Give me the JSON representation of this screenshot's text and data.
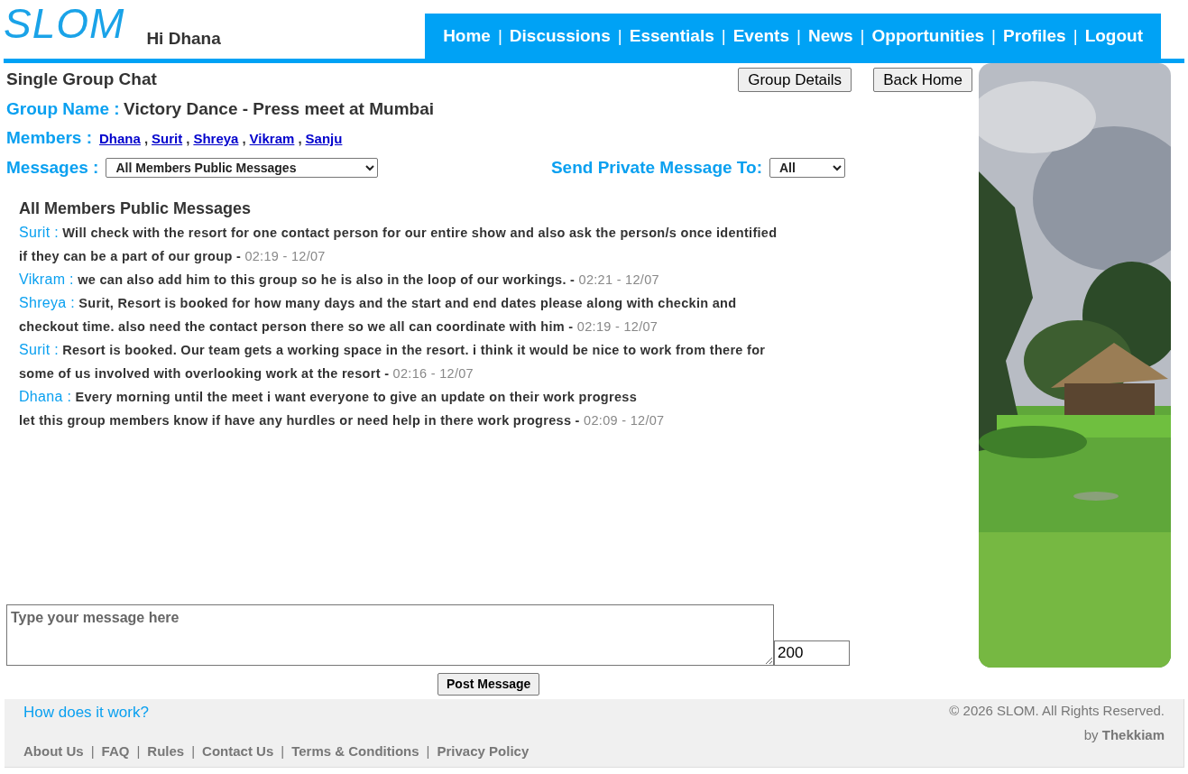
{
  "header": {
    "logo": "SLOM",
    "greeting": "Hi Dhana",
    "nav": [
      {
        "kind": "link",
        "label": "Home"
      },
      {
        "kind": "separator",
        "label": "|"
      },
      {
        "kind": "link",
        "label": "Discussions"
      },
      {
        "kind": "separator",
        "label": "|"
      },
      {
        "kind": "link",
        "label": "Essentials"
      },
      {
        "kind": "separator",
        "label": "|"
      },
      {
        "kind": "link",
        "label": "Events"
      },
      {
        "kind": "separator",
        "label": "|"
      },
      {
        "kind": "link",
        "label": "News"
      },
      {
        "kind": "separator",
        "label": "|"
      },
      {
        "kind": "link",
        "label": "Opportunities"
      },
      {
        "kind": "separator",
        "label": "|"
      },
      {
        "kind": "link",
        "label": "Profiles"
      },
      {
        "kind": "separator",
        "label": "|"
      },
      {
        "kind": "link",
        "label": "Logout"
      }
    ]
  },
  "page_title": "Single Group Chat",
  "buttons": [
    "Group Details",
    "Back Home"
  ],
  "group_name": {
    "label": "Group Name :",
    "value": "Victory Dance - Press meet at Mumbai"
  },
  "members": {
    "label": "Members :",
    "items": [
      {
        "kind": "link",
        "label": "Dhana"
      },
      {
        "kind": "separator",
        "label": ","
      },
      {
        "kind": "link",
        "label": "Surit"
      },
      {
        "kind": "separator",
        "label": ","
      },
      {
        "kind": "link",
        "label": "Shreya"
      },
      {
        "kind": "separator",
        "label": ","
      },
      {
        "kind": "link",
        "label": "Vikram"
      },
      {
        "kind": "separator",
        "label": ","
      },
      {
        "kind": "link",
        "label": "Sanju"
      }
    ]
  },
  "messages_filter": {
    "label": "Messages :",
    "value": "All Members Public Messages"
  },
  "private_to": {
    "label": "Send Private Message To:",
    "value": "All"
  },
  "chat": {
    "heading": "All Members Public Messages",
    "messages": [
      {
        "sender": "Surit :",
        "text": "Will check with the resort for one contact person for our entire show and also ask the person/s once identified if they can be a part of our group -",
        "time": "02:19 - 12/07"
      },
      {
        "sender": "Vikram :",
        "text": "we can also add him to this group so he is also in the loop of our workings. -",
        "time": "02:21 - 12/07"
      },
      {
        "sender": "Shreya :",
        "text": "Surit, Resort is booked for how many days and the start and end dates please along with checkin and checkout time. also need the contact person there so we all can coordinate with him -",
        "time": "02:19 - 12/07"
      },
      {
        "sender": "Surit :",
        "text": "Resort is booked. Our team gets a working space in the resort. i think it would be nice to work from there for some of us involved with overlooking work at the resort -",
        "time": "02:16 - 12/07"
      },
      {
        "sender": "Dhana :",
        "text": "Every morning until the meet i want everyone to give an update on their work progress\nlet this group members know if have any hurdles or need help in there work progress -",
        "time": "02:09 - 12/07"
      }
    ]
  },
  "composer": {
    "placeholder": "Type your message here",
    "counter": "200",
    "button": "Post Message"
  },
  "footer": {
    "help_link": "How does it work?",
    "copyright": "© 2026 SLOM. All Rights Reserved.",
    "credit": "by **Thekkiam**",
    "links": [
      {
        "kind": "link",
        "label": "About Us"
      },
      {
        "kind": "separator",
        "label": "|"
      },
      {
        "kind": "link",
        "label": "FAQ"
      },
      {
        "kind": "separator",
        "label": "|"
      },
      {
        "kind": "link",
        "label": "Rules"
      },
      {
        "kind": "separator",
        "label": "|"
      },
      {
        "kind": "link",
        "label": "Contact Us"
      },
      {
        "kind": "separator",
        "label": "|"
      },
      {
        "kind": "link",
        "label": "Terms & Conditions"
      },
      {
        "kind": "separator",
        "label": "|"
      },
      {
        "kind": "link",
        "label": "Privacy Policy"
      }
    ]
  }
}
